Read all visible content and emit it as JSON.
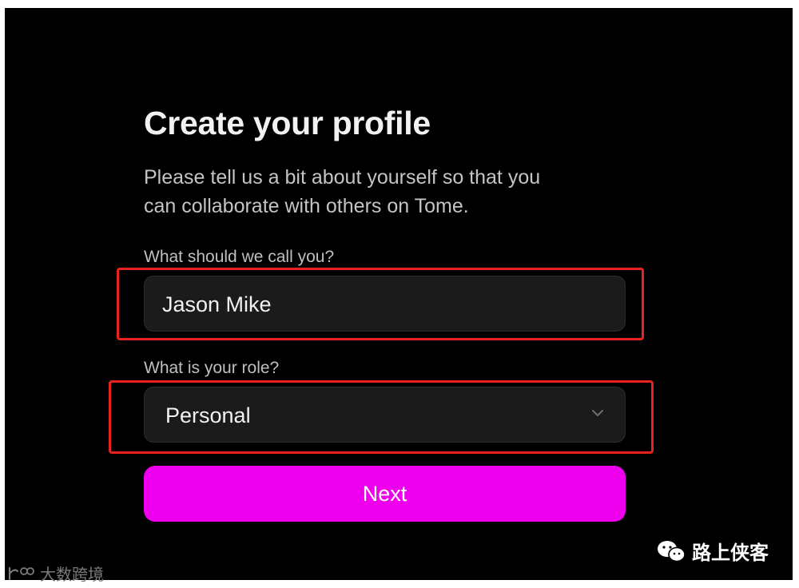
{
  "profile": {
    "title": "Create your profile",
    "subtitle_line1": "Please tell us a bit about yourself so that you",
    "subtitle_line2": "can collaborate with others on Tome.",
    "name_label": "What should we call you?",
    "name_value": "Jason Mike",
    "role_label": "What is your role?",
    "role_value": "Personal",
    "next_label": "Next"
  },
  "watermarks": {
    "left_text": "大数跨境",
    "right_text": "路上侠客"
  },
  "colors": {
    "background": "#000000",
    "input_bg": "#1b1b1b",
    "accent": "#ee00ee",
    "highlight": "#e8231f"
  },
  "icons": {
    "role_dropdown": "chevron-down-icon",
    "left_watermark": "logo-icon",
    "right_watermark": "wechat-icon"
  }
}
